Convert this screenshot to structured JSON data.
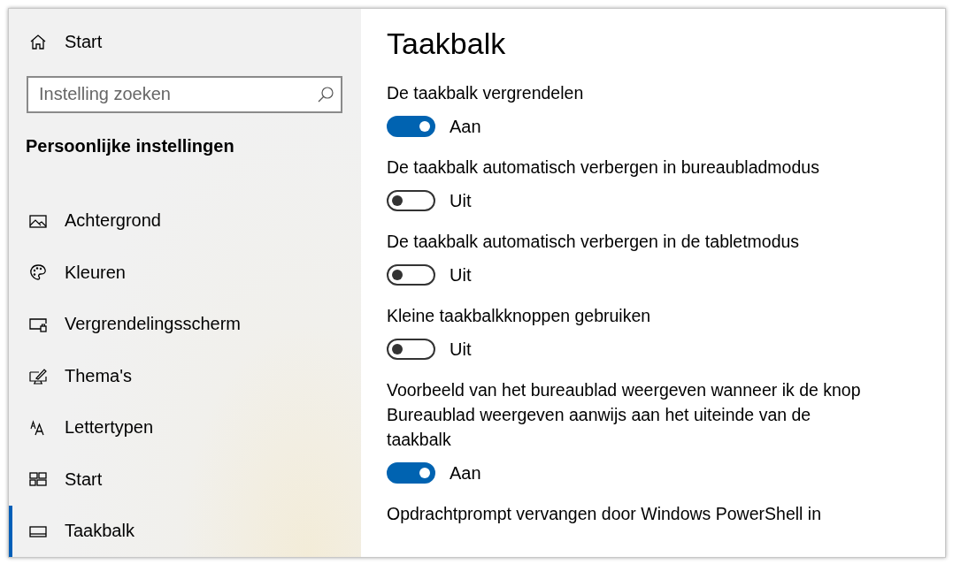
{
  "sidebar": {
    "home": "Start",
    "search": {
      "placeholder": "Instelling zoeken"
    },
    "heading": "Persoonlijke instellingen",
    "items": [
      {
        "label": "Achtergrond",
        "kind": "picture",
        "selected": false
      },
      {
        "label": "Kleuren",
        "kind": "palette",
        "selected": false
      },
      {
        "label": "Vergrendelingsscherm",
        "kind": "lockscreen",
        "selected": false
      },
      {
        "label": "Thema's",
        "kind": "theme",
        "selected": false
      },
      {
        "label": "Lettertypen",
        "kind": "font",
        "selected": false
      },
      {
        "label": "Start",
        "kind": "tiles",
        "selected": false
      },
      {
        "label": "Taakbalk",
        "kind": "taskbar",
        "selected": true
      }
    ]
  },
  "page": {
    "title": "Taakbalk",
    "settings": [
      {
        "label": "De taakbalk vergrendelen",
        "on": true,
        "state": "Aan"
      },
      {
        "label": "De taakbalk automatisch verbergen in bureaubladmodus",
        "on": false,
        "state": "Uit"
      },
      {
        "label": "De taakbalk automatisch verbergen in de tabletmodus",
        "on": false,
        "state": "Uit"
      },
      {
        "label": "Kleine taakbalkknoppen gebruiken",
        "on": false,
        "state": "Uit"
      },
      {
        "label": "Voorbeeld van het bureaublad weergeven wanneer ik de knop Bureaublad weergeven aanwijs aan het uiteinde van de taakbalk",
        "on": true,
        "state": "Aan"
      },
      {
        "label": "Opdrachtprompt vervangen door Windows PowerShell in"
      }
    ]
  }
}
